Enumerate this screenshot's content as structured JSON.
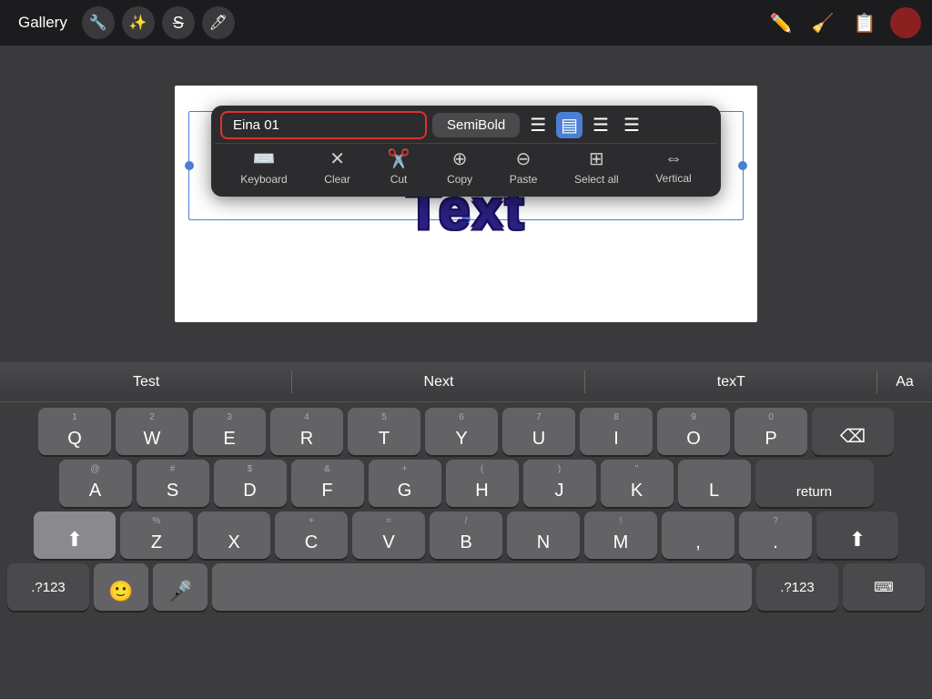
{
  "topbar": {
    "gallery_label": "Gallery",
    "icons": [
      "wrench",
      "magic",
      "strikethrough",
      "pen"
    ],
    "right_icons": [
      "pencil",
      "eraser",
      "layers"
    ],
    "avatar_color": "#8b2020"
  },
  "popup": {
    "font_name": "Eina 01",
    "font_weight": "SemiBold",
    "align_options": [
      "left",
      "center",
      "right",
      "justify"
    ],
    "active_align": "center",
    "actions": [
      {
        "icon": "⌨️",
        "label": "Keyboard"
      },
      {
        "icon": "✕",
        "label": "Clear"
      },
      {
        "icon": "✂️",
        "label": "Cut"
      },
      {
        "icon": "⊕",
        "label": "Copy"
      },
      {
        "icon": "⊖",
        "label": "Paste"
      },
      {
        "icon": "⊞",
        "label": "Select all"
      },
      {
        "icon": "⇔",
        "label": "Vertical"
      }
    ]
  },
  "canvas": {
    "text": "Text"
  },
  "autocorrect": {
    "suggestions": [
      "Test",
      "Next",
      "texT"
    ],
    "aa_label": "Aa"
  },
  "keyboard": {
    "row1": [
      {
        "label": "Q",
        "sub": "1"
      },
      {
        "label": "W",
        "sub": "2"
      },
      {
        "label": "E",
        "sub": "3"
      },
      {
        "label": "R",
        "sub": "4"
      },
      {
        "label": "T",
        "sub": "5"
      },
      {
        "label": "Y",
        "sub": "6"
      },
      {
        "label": "U",
        "sub": "7"
      },
      {
        "label": "I",
        "sub": "8"
      },
      {
        "label": "O",
        "sub": "9"
      },
      {
        "label": "P",
        "sub": "0"
      }
    ],
    "row2": [
      {
        "label": "A",
        "sub": "@"
      },
      {
        "label": "S",
        "sub": "#"
      },
      {
        "label": "D",
        "sub": "$"
      },
      {
        "label": "F",
        "sub": "&"
      },
      {
        "label": "G",
        "sub": "+"
      },
      {
        "label": "H",
        "sub": "("
      },
      {
        "label": "J",
        "sub": ")"
      },
      {
        "label": "K",
        "sub": "\""
      },
      {
        "label": "L",
        "sub": ""
      }
    ],
    "row3": [
      {
        "label": "Z",
        "sub": "%"
      },
      {
        "label": "X",
        "sub": ""
      },
      {
        "label": "C",
        "sub": "+"
      },
      {
        "label": "V",
        "sub": "="
      },
      {
        "label": "B",
        "sub": "/"
      },
      {
        "label": "N",
        "sub": ""
      },
      {
        "label": "M",
        "sub": "!"
      },
      {
        "label": ",",
        "sub": ""
      },
      {
        "label": ".",
        "sub": ""
      }
    ],
    "special": {
      "shift": "⬆",
      "delete": "⌫",
      "return": "return",
      "num123": ".?123",
      "emoji": "🙂",
      "mic": "🎤",
      "num123_right": ".?123",
      "keyboard_icon": "⌨"
    }
  }
}
